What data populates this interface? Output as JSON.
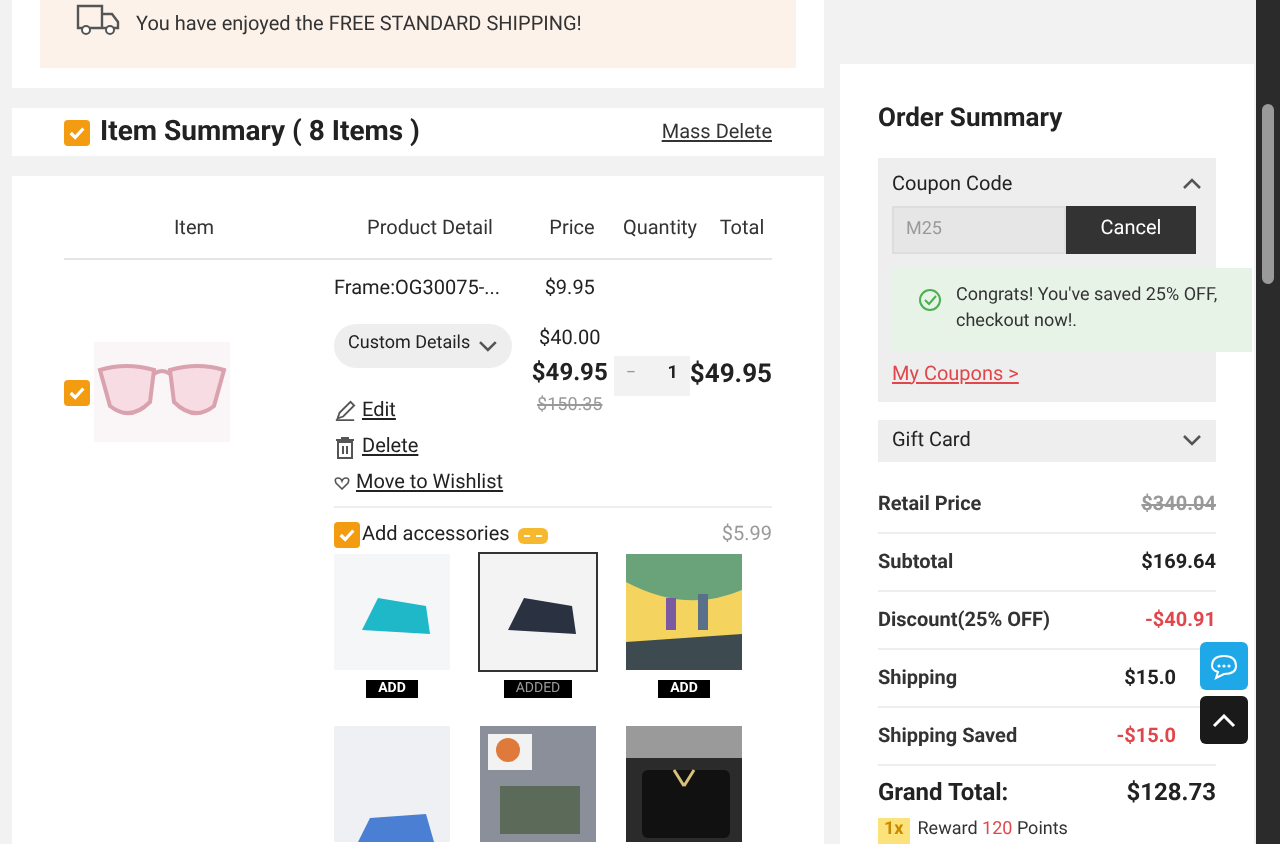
{
  "shipping_notice": {
    "message": "You have enjoyed the FREE STANDARD SHIPPING!"
  },
  "item_summary": {
    "title": "Item Summary ( 8 Items )",
    "checked": true,
    "mass_delete": "Mass Delete"
  },
  "table": {
    "columns": [
      "Item",
      "Product Detail",
      "Price",
      "Quantity",
      "Total"
    ],
    "rows": [
      {
        "checked": true,
        "frame": "Frame:OG30075-...",
        "custom_details": "Custom Details",
        "prices": [
          "$9.95",
          "$40.00"
        ],
        "price": "$49.95",
        "original_price": "$150.35",
        "decrement": "−",
        "quantity": "1",
        "total": "$49.95",
        "edit": "Edit",
        "delete": "Delete",
        "wishlist": "Move to Wishlist"
      }
    ]
  },
  "accessories": {
    "label": "Add accessories",
    "checked": true,
    "price": "$5.99",
    "items": [
      {
        "kind": "picture",
        "button": "ADD",
        "selected": false
      },
      {
        "kind": "picture",
        "button": "ADDED",
        "selected": true
      },
      {
        "kind": "picture",
        "button": "ADD",
        "selected": false
      },
      {
        "kind": "picture",
        "selected": false
      },
      {
        "kind": "picture",
        "selected": false
      },
      {
        "kind": "picture",
        "selected": false
      }
    ]
  },
  "order_summary": {
    "title": "Order Summary",
    "coupon": {
      "label": "Coupon Code",
      "expanded": true,
      "value": "M25",
      "button": "Cancel",
      "message": "Congrats! You've saved 25% OFF, checkout now!.",
      "link": "My Coupons >"
    },
    "gift_card": {
      "label": "Gift Card",
      "expanded": false
    },
    "lines": [
      {
        "label": "Retail Price",
        "value": "$340.04",
        "kind": "strike"
      },
      {
        "label": "Subtotal",
        "value": "$169.64",
        "kind": "normal"
      },
      {
        "label": "Discount(25% OFF)",
        "value": "-$40.91",
        "kind": "negative"
      },
      {
        "label": "Shipping",
        "value": "$15.0",
        "kind": "normal"
      },
      {
        "label": "Shipping Saved",
        "value": "-$15.0",
        "kind": "negative"
      }
    ],
    "grand_total": {
      "label": "Grand Total:",
      "value": "$128.73"
    },
    "reward": {
      "badge": "1x",
      "prefix": "Reward",
      "points": "120",
      "suffix": "Points"
    }
  }
}
